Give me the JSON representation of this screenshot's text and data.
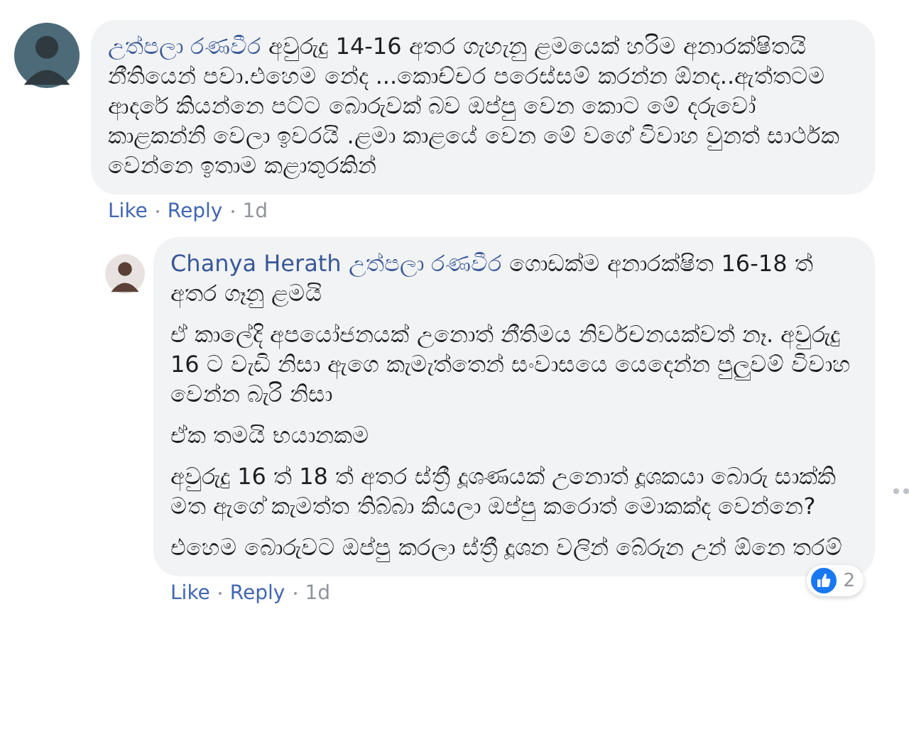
{
  "comments": [
    {
      "author": "උත්පලා රණවීර",
      "paragraphs": [
        "අවුරුදු 14-16 අතර ගැහැනු ළමයෙක් හරිම අනාරක්ෂිතයි නීතියෙන් පවා.එහෙම නේද ...කොච්චර පරෙස්සම් කරන්න ඕනද..ඇත්තටම ආදරේ කියන්නෙ පට්ට බොරුවක් බව ඔප්පු වෙන කොට මේ දරුවෝ කාළකන්නි වෙලා ඉවරයි .ළමා කාළයේ වෙන මේ වගේ විවාහ වුනත් සාර්ථක වෙන්නෙ ඉතාම කළාතුරකින්"
      ],
      "actions": [
        "Like",
        "Reply"
      ],
      "time": "1d",
      "children": [
        {
          "author": "Chanya Herath",
          "tag": "උත්පලා රණවීර",
          "paragraphs": [
            "ගොඩක්ම අනාරක්ෂිත 16-18 ත් අතර ගෑනු ළමයි",
            "ඒ කාලේදි අපයෝජනයක් උනොත් නීතිමය නිර්වචනයක්වත් නෑ. අවුරුදු 16 ට වැඩි නිසා ඇගෙ කැමැත්තෙන් සංවාසයෙ යෙදෙන්න පුලුවම් විවාහ වෙන්න බැරි නිසා",
            "ඒක තමයි භයානකම",
            "අවුරුදු 16 ත් 18 ත් අතර ස්ත්‍රී දූශණයක් උනොත් දූශකයා බොරු සාක්කි මත ඇගේ කැමත්ත තිබ්බා කියලා ඔප්පු කරොත් මොකක්ද වෙන්නෙ?",
            "එහෙම බොරුවට ඔප්පු කරලා ස්ත්‍රී දූශන වලින් බේරුන උන් ඕනෙ තරම්"
          ],
          "actions": [
            "Like",
            "Reply"
          ],
          "time": "1d",
          "reaction_count": "2"
        }
      ]
    }
  ]
}
